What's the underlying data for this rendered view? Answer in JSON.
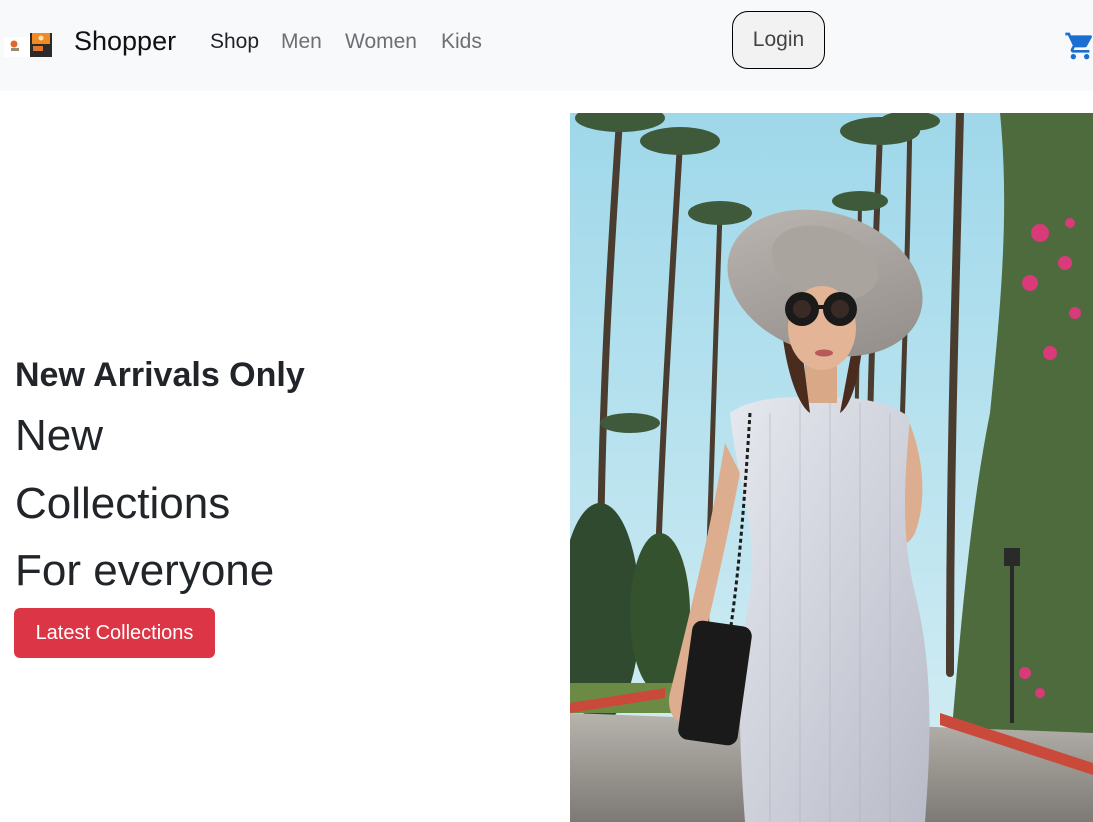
{
  "navbar": {
    "brand_name": "Shopper",
    "links": [
      {
        "label": "Shop",
        "active": true
      },
      {
        "label": "Men",
        "active": false
      },
      {
        "label": "Women",
        "active": false
      },
      {
        "label": "Kids",
        "active": false
      }
    ],
    "login_label": "Login",
    "cart_icon": "cart-icon",
    "background": "#f8f9fa"
  },
  "hero": {
    "subtitle": "New Arrivals Only",
    "headline_lines": [
      "New",
      "Collections",
      "For everyone"
    ],
    "cta_label": "Latest Collections",
    "cta_color": "#dc3545",
    "image": "woman-in-white-dress-and-hat-photo"
  },
  "colors": {
    "accent_blue": "#1b6fd1",
    "text_dark": "#212529"
  }
}
